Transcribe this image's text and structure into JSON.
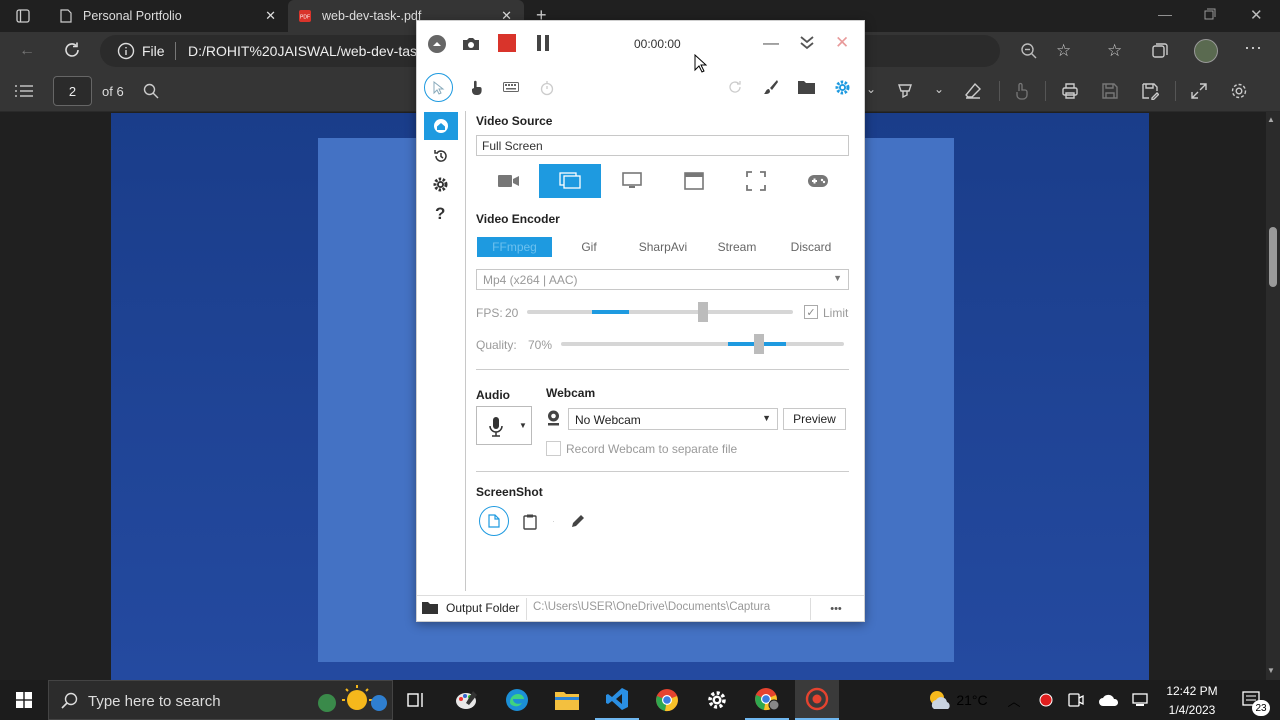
{
  "browser": {
    "tabs": [
      {
        "title": "Personal Portfolio"
      },
      {
        "title": "web-dev-task-.pdf"
      }
    ],
    "address": {
      "scheme": "File",
      "url": "D:/ROHIT%20JAISWAL/web-dev-task"
    }
  },
  "pdf": {
    "page_number": "2",
    "page_total": "of 6"
  },
  "captura": {
    "timer": "00:00:00",
    "video_source": {
      "title": "Video Source",
      "value": "Full Screen",
      "modes": [
        "webcam-icon",
        "screen-icon",
        "monitor-icon",
        "window-icon",
        "region-icon",
        "gamepad-icon"
      ]
    },
    "video_encoder": {
      "title": "Video Encoder",
      "tabs": [
        "FFmpeg",
        "Gif",
        "SharpAvi",
        "Stream",
        "Discard"
      ],
      "codec": "Mp4 (x264 | AAC)",
      "fps_label": "FPS:",
      "fps_value": "20",
      "fps_level": 0.66,
      "limit_label": "Limit",
      "quality_label": "Quality:",
      "quality_value": "70%",
      "quality_level": 0.7
    },
    "audio": {
      "title": "Audio"
    },
    "webcam": {
      "title": "Webcam",
      "value": "No Webcam",
      "preview_label": "Preview",
      "separate_label": "Record Webcam to separate file"
    },
    "screenshot": {
      "title": "ScreenShot"
    },
    "output": {
      "label": "Output Folder",
      "path": "C:\\Users\\USER\\OneDrive\\Documents\\Captura",
      "more": "•••"
    }
  },
  "taskbar": {
    "search_placeholder": "Type here to search",
    "weather": "21°C",
    "time": "12:42 PM",
    "date": "1/4/2023",
    "notifications": "23"
  },
  "colors": {
    "accent": "#1e9ae0",
    "stop": "#d9342b",
    "page_blue": "#4472c4"
  }
}
